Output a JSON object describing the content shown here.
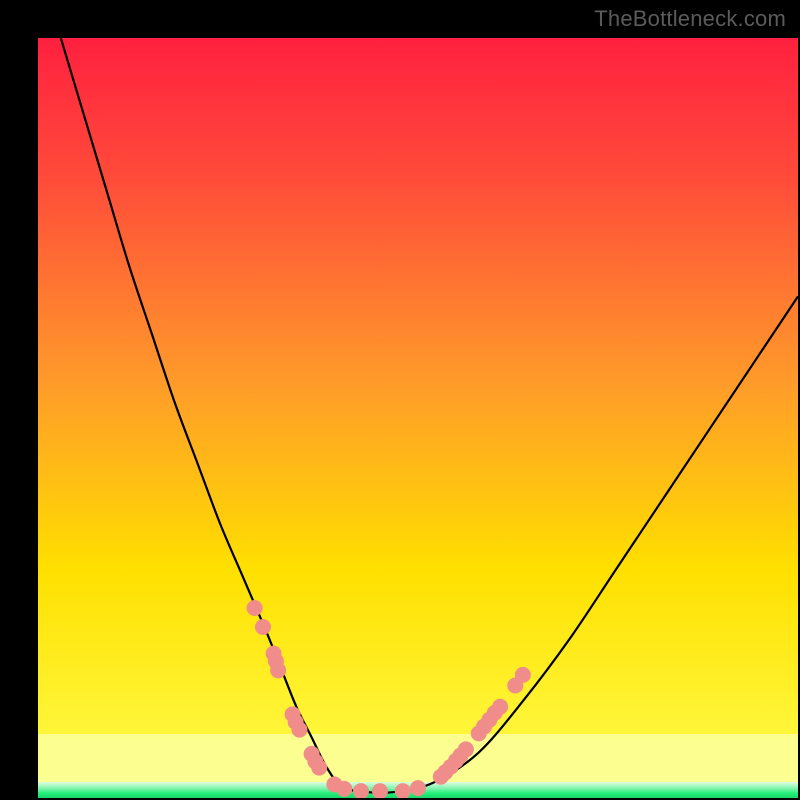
{
  "watermark": "TheBottleneck.com",
  "colors": {
    "top": "#ff203f",
    "mid": "#ffe000",
    "bottomYellow": "#ffff50",
    "bottomBand": "#fcff9d",
    "green": "#25f07a",
    "curve": "#000000",
    "beads": "#f08d8a",
    "frame": "#000000"
  },
  "chart_data": {
    "type": "line",
    "title": "",
    "xlabel": "",
    "ylabel": "",
    "xlim": [
      0,
      100
    ],
    "ylim": [
      0,
      100
    ],
    "legend": false,
    "grid": false,
    "series": [
      {
        "name": "bottleneck-curve",
        "x": [
          3,
          6,
          9,
          12,
          15,
          18,
          21,
          24,
          27,
          30,
          32,
          34,
          36,
          38,
          40,
          43,
          47,
          52,
          58,
          64,
          70,
          76,
          82,
          88,
          94,
          100
        ],
        "y": [
          100,
          90,
          80,
          70,
          61,
          52,
          44,
          36,
          29,
          22,
          17,
          12,
          8,
          4,
          1.5,
          0.8,
          0.8,
          2,
          6,
          13,
          21,
          30,
          39,
          48,
          57,
          66
        ]
      }
    ],
    "markers": [
      {
        "name": "bead-cluster-left",
        "points_x": [
          28.5,
          29.6,
          31.0,
          31.3,
          31.6,
          33.5,
          33.9,
          34.4,
          36.0,
          36.5,
          37.0
        ],
        "points_y": [
          25.0,
          22.5,
          19.0,
          18.0,
          16.8,
          11.0,
          10.0,
          9.0,
          5.8,
          4.8,
          4.0
        ]
      },
      {
        "name": "bead-cluster-bottom",
        "points_x": [
          39.0,
          40.3,
          42.5,
          45.0,
          48.0,
          50.0
        ],
        "points_y": [
          1.8,
          1.2,
          0.9,
          0.9,
          0.9,
          1.3
        ]
      },
      {
        "name": "bead-cluster-right",
        "points_x": [
          53.0,
          53.6,
          54.3,
          55.0,
          55.6,
          56.3,
          58.0,
          58.7,
          59.4,
          60.1,
          60.8,
          62.8,
          63.8
        ],
        "points_y": [
          2.8,
          3.4,
          4.1,
          4.9,
          5.6,
          6.4,
          8.5,
          9.4,
          10.3,
          11.2,
          12.0,
          14.8,
          16.2
        ]
      }
    ]
  }
}
